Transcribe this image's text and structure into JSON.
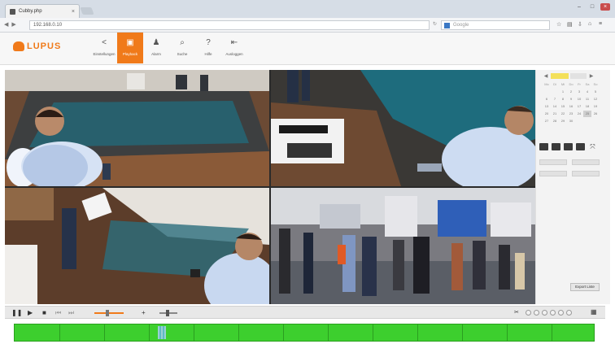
{
  "browser": {
    "tab_title": "Cubby.php",
    "tab_close": "×",
    "url": "192.168.0.10",
    "search_placeholder": "Google",
    "window_controls": [
      "–",
      "□",
      "×"
    ]
  },
  "app": {
    "brand": "LUPUS",
    "menu": [
      {
        "label": "Einstellungen",
        "icon": "share-icon"
      },
      {
        "label": "Playback",
        "icon": "playback-icon",
        "active": true
      },
      {
        "label": "Alarm",
        "icon": "bell-icon"
      },
      {
        "label": "Suche",
        "icon": "search-icon"
      },
      {
        "label": "Hilfe",
        "icon": "help-icon"
      },
      {
        "label": "Ausloggen",
        "icon": "logout-icon"
      }
    ],
    "accent_color": "#f07a1a"
  },
  "calendar": {
    "weekdays": [
      "Mo",
      "Di",
      "Mi",
      "Do",
      "Fr",
      "Sa",
      "So"
    ],
    "days": [
      "",
      "",
      "1",
      "2",
      "3",
      "4",
      "5",
      "6",
      "7",
      "8",
      "9",
      "10",
      "11",
      "12",
      "13",
      "14",
      "15",
      "16",
      "17",
      "18",
      "19",
      "20",
      "21",
      "22",
      "23",
      "24",
      "25",
      "26",
      "27",
      "28",
      "29",
      "30",
      "",
      "",
      ""
    ],
    "selected_day": "25"
  },
  "panel": {
    "export_label": "Export Liste"
  },
  "timeline": {
    "color": "#3dcf2e"
  }
}
